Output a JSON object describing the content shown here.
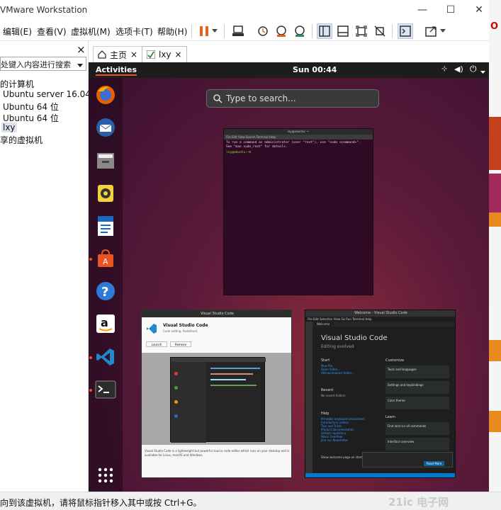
{
  "window": {
    "title": "VMware Workstation",
    "minimize": "—",
    "maximize": "☐",
    "close": "✕"
  },
  "menubar": {
    "items": [
      "编辑(E)",
      "查看(V)",
      "虚拟机(M)",
      "选项卡(T)",
      "帮助(H)"
    ]
  },
  "library": {
    "close": "×",
    "search_placeholder": "处键入内容进行搜索",
    "root": "的计算机",
    "vms": [
      "Ubuntu server 16.04",
      "Ubuntu 64 位",
      "Ubuntu 64 位",
      "lxy"
    ],
    "shared": "享的虚拟机"
  },
  "tabs": [
    {
      "label": "主页",
      "icon": "home-icon"
    },
    {
      "label": "lxy",
      "icon": "vm-console-icon"
    }
  ],
  "tab_close": "×",
  "guest": {
    "activities": "Activities",
    "clock": "Sun 00:44",
    "search_placeholder": "Type to search...",
    "dock_apps": [
      "firefox-icon",
      "thunderbird-icon",
      "files-icon",
      "rhythmbox-icon",
      "writer-icon",
      "software-icon",
      "help-icon",
      "amazon-icon",
      "vscode-icon",
      "terminal-icon",
      "show-apps-icon"
    ],
    "terminal": {
      "title": "lxy@ubuntu: ~",
      "menu": "File   Edit   View   Search   Terminal   Help",
      "lines": [
        "To run a command as administrator (user \"root\"), use \"sudo <command>\".",
        "See \"man sudo_root\" for details.",
        "lxy@ubuntu:~$"
      ]
    },
    "store": {
      "title": "Visual Studio Code",
      "app_name": "Visual Studio Code",
      "app_sub": "Code editing. Redefined.",
      "launch": "Launch",
      "remove": "Remove",
      "desc": "Visual Studio Code is a lightweight but powerful source code editor which runs on your desktop and is available for Linux, macOS and Windows."
    },
    "vscode": {
      "title": "Welcome - Visual Studio Code",
      "menu": "File  Edit  Selection  View  Go  Run  Terminal  Help",
      "tab": "Welcome",
      "heading": "Visual Studio Code",
      "subheading": "Editing evolved",
      "start": "Start",
      "start_links": [
        "New file",
        "Open folder...",
        "Add workspace folder..."
      ],
      "recent": "Recent",
      "recent_text": "No recent folders",
      "help": "Help",
      "help_links": [
        "Printable keyboard cheatsheet",
        "Introductory videos",
        "Tips and Tricks",
        "Product documentation",
        "GitHub repository",
        "Stack Overflow",
        "Join our Newsletter"
      ],
      "customize": "Customize",
      "cards": [
        "Tools and languages",
        "Settings and keybindings",
        "Color theme"
      ],
      "learn": "Learn",
      "learn_cards": [
        "Find and run all commands",
        "Interface overview"
      ],
      "show_welcome": "Show welcome page on startup",
      "read_more": "Read More"
    }
  },
  "status": {
    "text": "向到该虚拟机，请将鼠标指针移入其中或按 Ctrl+G。",
    "watermark": "21ic 电子网"
  },
  "colors": {
    "ubuntu_orange": "#e95420",
    "terminal_bg": "#300a24",
    "vscode_blue": "#0078d4"
  }
}
